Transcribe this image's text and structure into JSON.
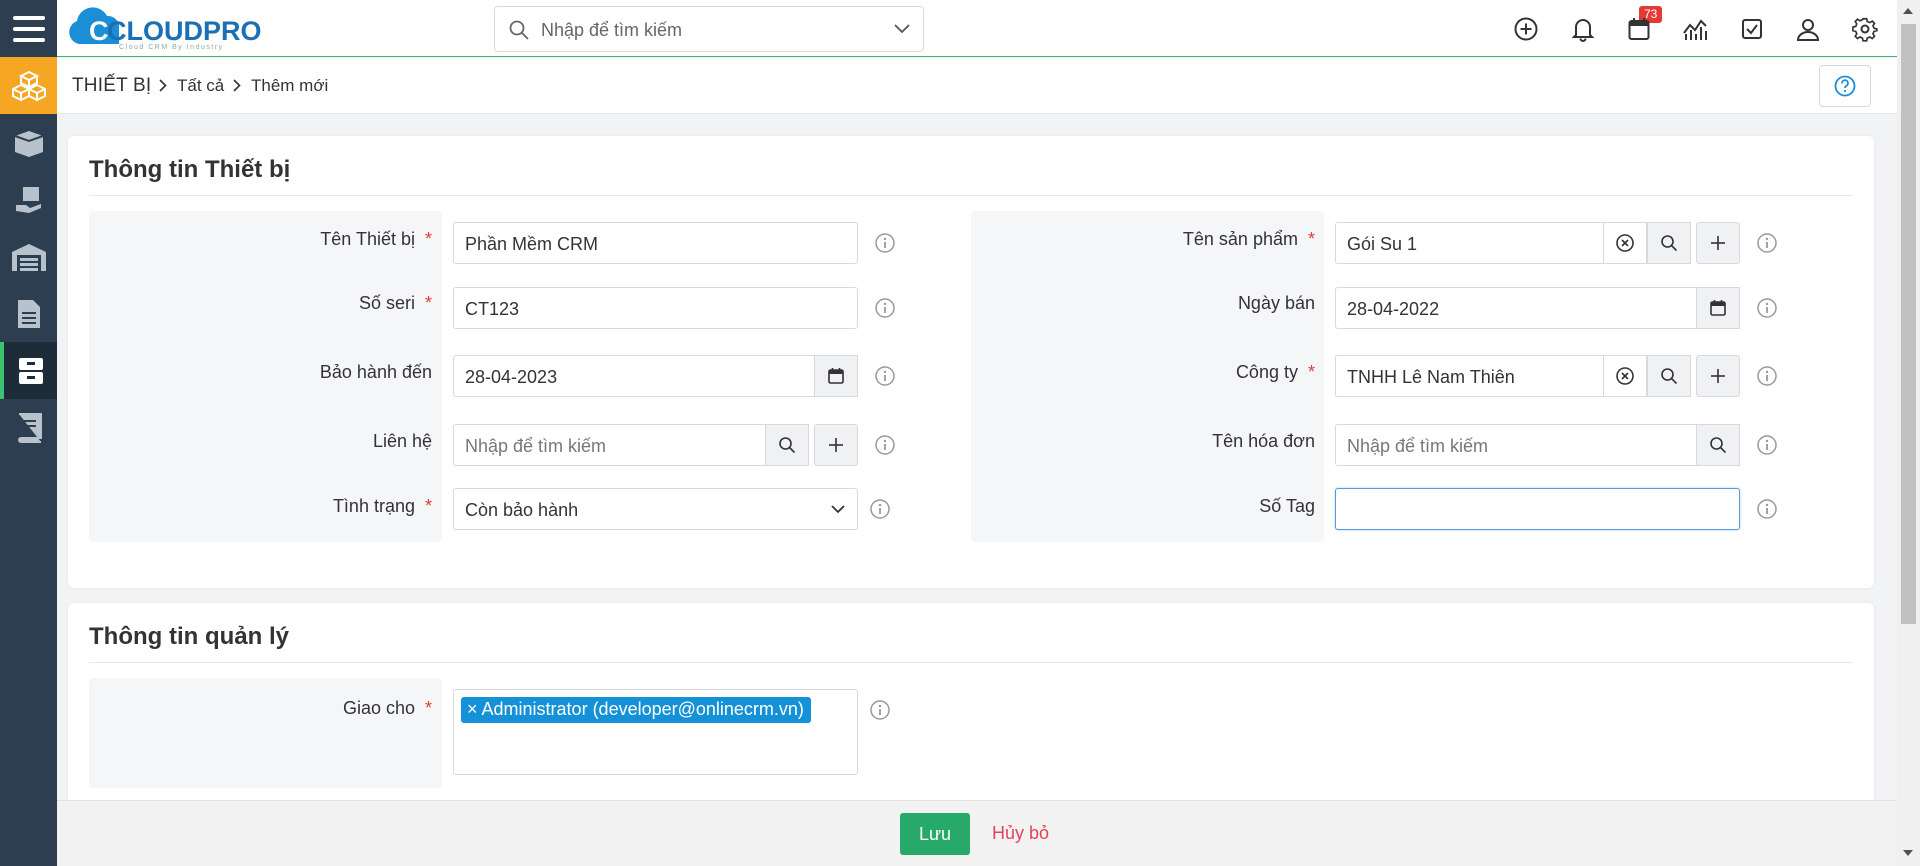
{
  "app": {
    "logo_text": "CLOUDPRO",
    "logo_tagline": "Cloud CRM By Industry"
  },
  "topbar": {
    "search_placeholder": "Nhập để tìm kiếm",
    "notification_count": "73",
    "icons": [
      "add-circle-icon",
      "bell-icon",
      "calendar-icon",
      "chart-icon",
      "checkbox-icon",
      "user-icon",
      "gear-icon"
    ]
  },
  "breadcrumb": {
    "module": "THIẾT BỊ",
    "level2": "Tất cả",
    "level3": "Thêm mới"
  },
  "section_device": {
    "title": "Thông tin Thiết bị",
    "left": {
      "device_name": {
        "label": "Tên Thiết bị",
        "value": "Phần Mềm CRM"
      },
      "serial": {
        "label": "Số seri",
        "value": "CT123"
      },
      "warranty": {
        "label": "Bảo hành đến",
        "value": "28-04-2023"
      },
      "contact": {
        "label": "Liên hệ",
        "placeholder": "Nhập để tìm kiếm"
      },
      "status": {
        "label": "Tình trạng",
        "value": "Còn bảo hành"
      }
    },
    "right": {
      "product": {
        "label": "Tên sản phẩm",
        "value": "Gói Su 1"
      },
      "sale_date": {
        "label": "Ngày bán",
        "value": "28-04-2022"
      },
      "company": {
        "label": "Công ty",
        "value": "TNHH Lê Nam Thiên"
      },
      "invoice": {
        "label": "Tên hóa đơn",
        "placeholder": "Nhập để tìm kiếm"
      },
      "tag": {
        "label": "Số Tag",
        "value": ""
      }
    }
  },
  "section_manage": {
    "title": "Thông tin quản lý",
    "assign": {
      "label": "Giao cho",
      "tag_remove": "×",
      "tag_value": "Administrator (developer@onlinecrm.vn)"
    }
  },
  "footer": {
    "save": "Lưu",
    "cancel": "Hủy bỏ"
  },
  "required_mark": "*",
  "colors": {
    "nav_bg": "#2c3e50",
    "nav_active": "#f5a623",
    "save_green": "#27a96a",
    "cancel_red": "#e0455c",
    "tag_blue": "#1591d8",
    "required": "#e53935"
  }
}
